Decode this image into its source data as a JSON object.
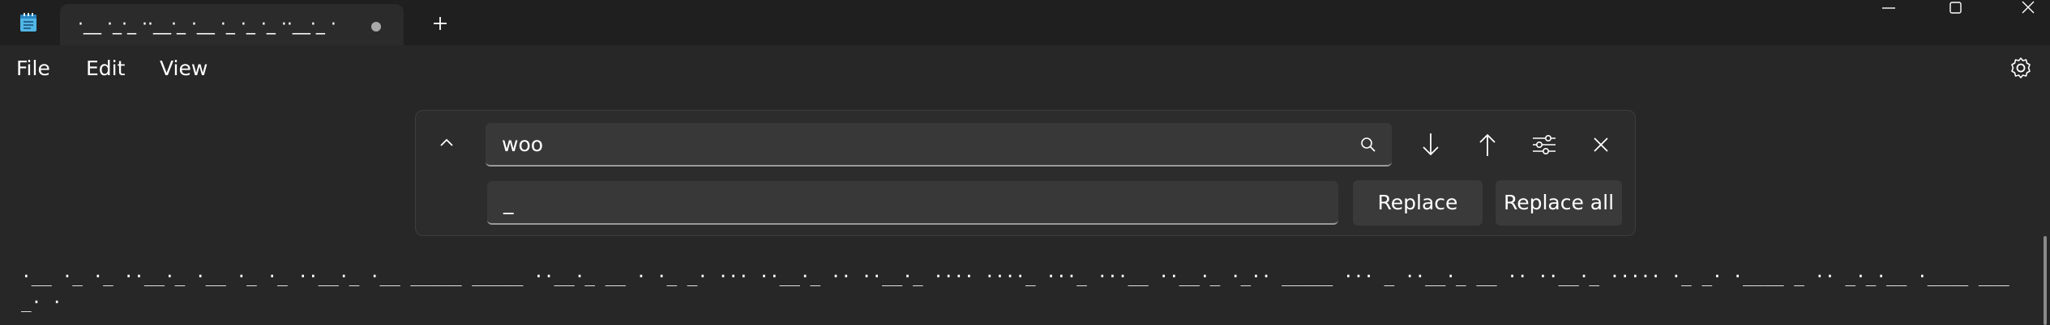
{
  "tab": {
    "title": "·__ ·_·_ ··__·_ ·__ ·_ ·_ ·_ ··__·_ ·",
    "app_icon": "notepad-icon",
    "unsaved_indicator": "dot",
    "new_tab_icon": "plus-icon"
  },
  "window_controls": {
    "minimize_icon": "minimize-icon",
    "maximize_icon": "maximize-icon",
    "close_icon": "close-icon"
  },
  "menu": {
    "items": [
      {
        "label": "File"
      },
      {
        "label": "Edit"
      },
      {
        "label": "View"
      }
    ],
    "settings_icon": "gear-icon"
  },
  "find_panel": {
    "collapse_icon": "chevron-up-icon",
    "search_value": "woo",
    "search_icon": "search-icon",
    "next_icon": "arrow-down-icon",
    "previous_icon": "arrow-up-icon",
    "options_icon": "sliders-icon",
    "close_icon": "close-icon",
    "replace_value": "_",
    "replace_label": "Replace",
    "replace_all_label": "Replace all"
  },
  "editor": {
    "content": "·__ ·_ ·_ ··__·_ ·__ ·_ ·_ ··__·_ ·__ _____ _____ ··__·_ __ · ·_ _· ··· ··__·_ ·· ··__·_ ···· ····_ ···_ ···__ ··__·_ ·_·· _____ ··· _ ··__·_ __ ·· ··__·_ ····· ·_ _· ·____ _ ·· _·_·__ ·____ ___ _· ·"
  },
  "colors": {
    "background": "#272727",
    "titlebar": "#1f1f1f",
    "panel": "#2c2c2c",
    "input": "#383838",
    "button": "#3a3a3a",
    "text": "#ffffff"
  }
}
